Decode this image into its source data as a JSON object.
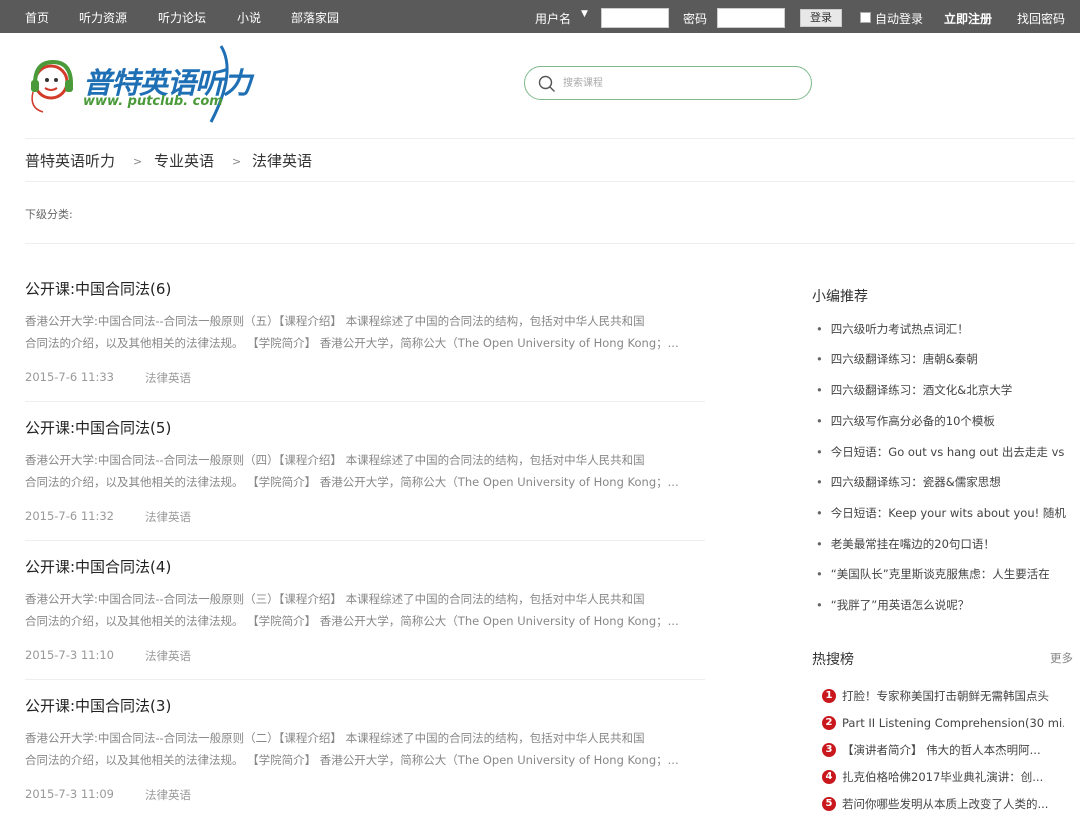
{
  "nav": {
    "items": [
      "首页",
      "听力资源",
      "听力论坛",
      "小说",
      "部落家园"
    ]
  },
  "login": {
    "username_label": "用户名",
    "password_label": "密码",
    "login_button": "登录",
    "auto_login": "自动登录",
    "register": "立即注册",
    "recover": "找回密码"
  },
  "logo": {
    "name": "普特英语听力",
    "url_text": "www. putclub. com"
  },
  "search": {
    "placeholder": "搜索课程"
  },
  "breadcrumb": [
    "普特英语听力",
    "专业英语",
    "法律英语"
  ],
  "breadcrumb_sep": ">",
  "subcategory_label": "下级分类:",
  "articles": [
    {
      "title": "公开课:中国合同法(6)",
      "line1": "香港公开大学:中国合同法--合同法一般原则（五）【课程介绍】 本课程综述了中国的合同法的结构，包括对中华人民共和国",
      "line2": "合同法的介绍，以及其他相关的法律法规。 【学院简介】 香港公开大学，简称公大（The Open University of Hong Kong；...",
      "date": "2015-7-6 11:33",
      "category": "法律英语"
    },
    {
      "title": "公开课:中国合同法(5)",
      "line1": "香港公开大学:中国合同法--合同法一般原则（四）【课程介绍】 本课程综述了中国的合同法的结构，包括对中华人民共和国",
      "line2": "合同法的介绍，以及其他相关的法律法规。 【学院简介】 香港公开大学，简称公大（The Open University of Hong Kong；...",
      "date": "2015-7-6 11:32",
      "category": "法律英语"
    },
    {
      "title": "公开课:中国合同法(4)",
      "line1": "香港公开大学:中国合同法--合同法一般原则（三）【课程介绍】 本课程综述了中国的合同法的结构，包括对中华人民共和国",
      "line2": "合同法的介绍，以及其他相关的法律法规。 【学院简介】 香港公开大学，简称公大（The Open University of Hong Kong；...",
      "date": "2015-7-3 11:10",
      "category": "法律英语"
    },
    {
      "title": "公开课:中国合同法(3)",
      "line1": "香港公开大学:中国合同法--合同法一般原则（二）【课程介绍】 本课程综述了中国的合同法的结构，包括对中华人民共和国",
      "line2": "合同法的介绍，以及其他相关的法律法规。 【学院简介】 香港公开大学，简称公大（The Open University of Hong Kong；...",
      "date": "2015-7-3 11:09",
      "category": "法律英语"
    }
  ],
  "recommend": {
    "title": "小编推荐",
    "items": [
      "四六级听力考试热点词汇！",
      "四六级翻译练习：唐朝&秦朝",
      "四六级翻译练习：酒文化&北京大学",
      "四六级写作高分必备的10个模板",
      "今日短语：Go out vs hang out 出去走走 vs",
      "四六级翻译练习：瓷器&儒家思想",
      "今日短语：Keep your wits about you! 随机",
      "老美最常挂在嘴边的20句口语！",
      "“美国队长”克里斯谈克服焦虑：人生要活在",
      "“我胖了”用英语怎么说呢？"
    ]
  },
  "hot": {
    "title": "热搜榜",
    "more": "更多",
    "items": [
      {
        "num": "1",
        "text": "打脸！专家称美国打击朝鲜无需韩国点头"
      },
      {
        "num": "2",
        "text": "Part II Listening Comprehension(30 mi..."
      },
      {
        "num": "3",
        "text": "【演讲者简介】 伟大的哲人本杰明阿..."
      },
      {
        "num": "4",
        "text": "扎克伯格哈佛2017毕业典礼演讲：创..."
      },
      {
        "num": "5",
        "text": "若问你哪些发明从本质上改变了人类的..."
      }
    ]
  },
  "colors": {
    "topbar": "#5a5a5a",
    "search_border": "#7fb98a",
    "hot_badge": "#c9171e",
    "logo_blue": "#1f6fb5",
    "logo_green": "#4a9a3a"
  }
}
